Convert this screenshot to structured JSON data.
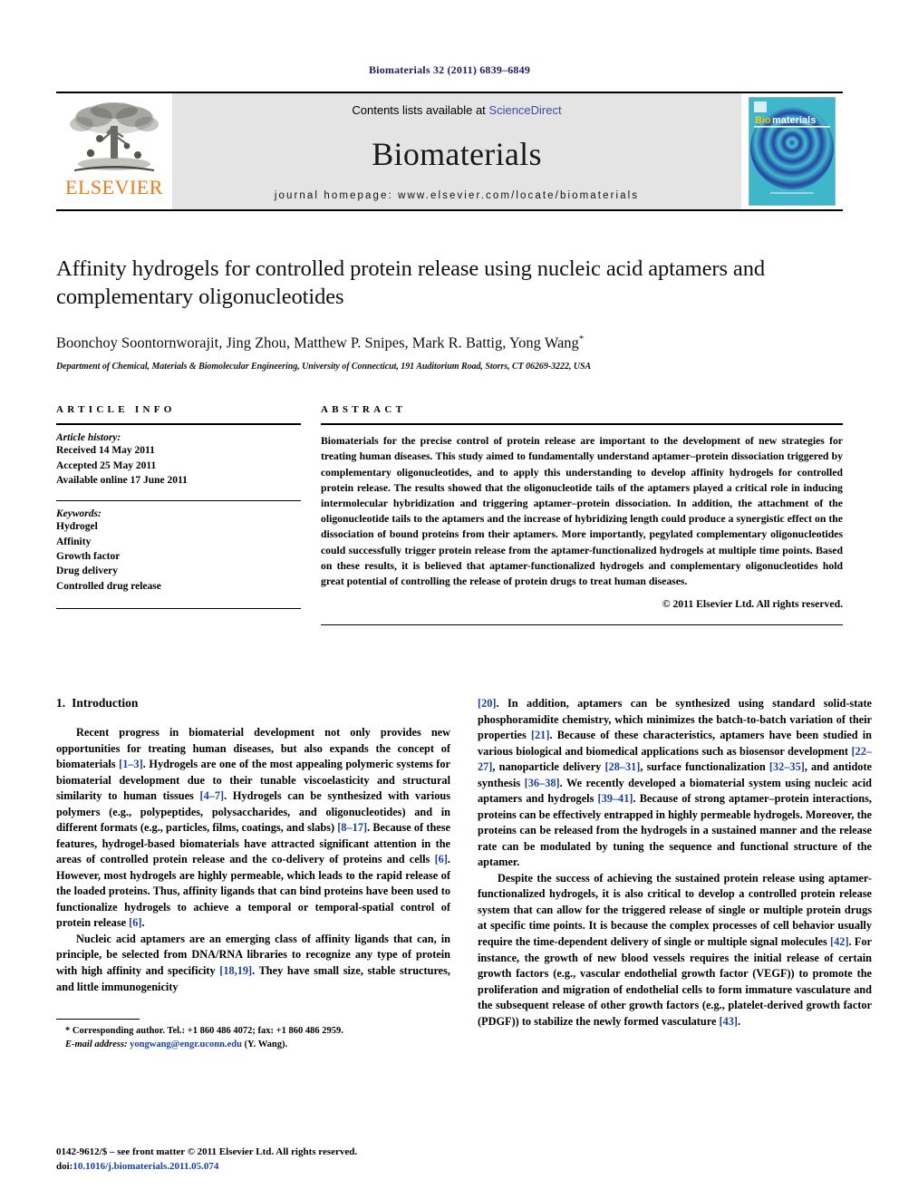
{
  "running_head": "Biomaterials 32 (2011) 6839–6849",
  "masthead": {
    "publisher_wordmark": "ELSEVIER",
    "contents_prefix": "Contents lists available at ",
    "contents_link": "ScienceDirect",
    "journal_name": "Biomaterials",
    "homepage": "journal homepage: www.elsevier.com/locate/biomaterials",
    "cover_title_part1": "Bio",
    "cover_title_part2": "materials"
  },
  "article": {
    "title": "Affinity hydrogels for controlled protein release using nucleic acid aptamers and complementary oligonucleotides",
    "authors": "Boonchoy Soontornworajit, Jing Zhou, Matthew P. Snipes, Mark R. Battig, Yong Wang",
    "author_marker": "*",
    "affiliation": "Department of Chemical, Materials & Biomolecular Engineering, University of Connecticut, 191 Auditorium Road, Storrs, CT 06269-3222, USA"
  },
  "info": {
    "heading": "ARTICLE INFO",
    "history_label": "Article history:",
    "history": [
      "Received 14 May 2011",
      "Accepted 25 May 2011",
      "Available online 17 June 2011"
    ],
    "keywords_label": "Keywords:",
    "keywords": [
      "Hydrogel",
      "Affinity",
      "Growth factor",
      "Drug delivery",
      "Controlled drug release"
    ]
  },
  "abstract": {
    "heading": "ABSTRACT",
    "text": "Biomaterials for the precise control of protein release are important to the development of new strategies for treating human diseases. This study aimed to fundamentally understand aptamer–protein dissociation triggered by complementary oligonucleotides, and to apply this understanding to develop affinity hydrogels for controlled protein release. The results showed that the oligonucleotide tails of the aptamers played a critical role in inducing intermolecular hybridization and triggering aptamer–protein dissociation. In addition, the attachment of the oligonucleotide tails to the aptamers and the increase of hybridizing length could produce a synergistic effect on the dissociation of bound proteins from their aptamers. More importantly, pegylated complementary oligonucleotides could successfully trigger protein release from the aptamer-functionalized hydrogels at multiple time points. Based on these results, it is believed that aptamer-functionalized hydrogels and complementary oligonucleotides hold great potential of controlling the release of protein drugs to treat human diseases.",
    "copyright": "© 2011 Elsevier Ltd. All rights reserved."
  },
  "section": {
    "number": "1.",
    "title": "Introduction"
  },
  "left_column": {
    "p1_a": "Recent progress in biomaterial development not only provides new opportunities for treating human diseases, but also expands the concept of biomaterials ",
    "p1_r1": "[1–3]",
    "p1_b": ". Hydrogels are one of the most appealing polymeric systems for biomaterial development due to their tunable viscoelasticity and structural similarity to human tissues ",
    "p1_r2": "[4–7]",
    "p1_c": ". Hydrogels can be synthesized with various polymers (e.g., polypeptides, polysaccharides, and oligonucleotides) and in different formats (e.g., particles, films, coatings, and slabs) ",
    "p1_r3": "[8–17]",
    "p1_d": ". Because of these features, hydrogel-based biomaterials have attracted significant attention in the areas of controlled protein release and the co-delivery of proteins and cells ",
    "p1_r4": "[6]",
    "p1_e": ". However, most hydrogels are highly permeable, which leads to the rapid release of the loaded proteins. Thus, affinity ligands that can bind proteins have been used to functionalize hydrogels to achieve a temporal or temporal-spatial control of protein release ",
    "p1_r5": "[6]",
    "p1_f": ".",
    "p2_a": "Nucleic acid aptamers are an emerging class of affinity ligands that can, in principle, be selected from DNA/RNA libraries to recognize any type of protein with high affinity and specificity ",
    "p2_r1": "[18,19]",
    "p2_b": ". They have small size, stable structures, and little immunogenicity"
  },
  "right_column": {
    "p_cont_r0": "[20]",
    "p_cont_a": ". In addition, aptamers can be synthesized using standard solid-state phosphoramidite chemistry, which minimizes the batch-to-batch variation of their properties ",
    "p_cont_r1": "[21]",
    "p_cont_b": ". Because of these characteristics, aptamers have been studied in various biological and biomedical applications such as biosensor development ",
    "p_cont_r2": "[22–27]",
    "p_cont_c": ", nanoparticle delivery ",
    "p_cont_r3": "[28–31]",
    "p_cont_d": ", surface functionalization ",
    "p_cont_r4": "[32–35]",
    "p_cont_e": ", and antidote synthesis ",
    "p_cont_r5": "[36–38]",
    "p_cont_f": ". We recently developed a biomaterial system using nucleic acid aptamers and hydrogels ",
    "p_cont_r6": "[39–41]",
    "p_cont_g": ". Because of strong aptamer–protein interactions, proteins can be effectively entrapped in highly permeable hydrogels. Moreover, the proteins can be released from the hydrogels in a sustained manner and the release rate can be modulated by tuning the sequence and functional structure of the aptamer.",
    "p2_a": "Despite the success of achieving the sustained protein release using aptamer-functionalized hydrogels, it is also critical to develop a controlled protein release system that can allow for the triggered release of single or multiple protein drugs at specific time points. It is because the complex processes of cell behavior usually require the time-dependent delivery of single or multiple signal molecules ",
    "p2_r1": "[42]",
    "p2_b": ". For instance, the growth of new blood vessels requires the initial release of certain growth factors (e.g., vascular endothelial growth factor (VEGF)) to promote the proliferation and migration of endothelial cells to form immature vasculature and the subsequent release of other growth factors (e.g., platelet-derived growth factor (PDGF)) to stabilize the newly formed vasculature ",
    "p2_r2": "[43]",
    "p2_c": "."
  },
  "footnote": {
    "star": "*",
    "corresponding": " Corresponding author. Tel.: +1 860 486 4072; fax: +1 860 486 2959.",
    "email_label": "E-mail address:",
    "email": "yongwang@engr.uconn.edu",
    "email_suffix": " (Y. Wang)."
  },
  "colophon": {
    "line1": "0142-9612/$ – see front matter © 2011 Elsevier Ltd. All rights reserved.",
    "doi_label": "doi:",
    "doi_value": "10.1016/j.biomaterials.2011.05.074"
  },
  "colors": {
    "elsevier_orange": "#e87b1e",
    "link_blue": "#1a3fa0",
    "sciencedirect_blue": "#3b4ba8",
    "running_head_navy": "#1a1a5e",
    "masthead_gray": "#e4e4e4"
  }
}
